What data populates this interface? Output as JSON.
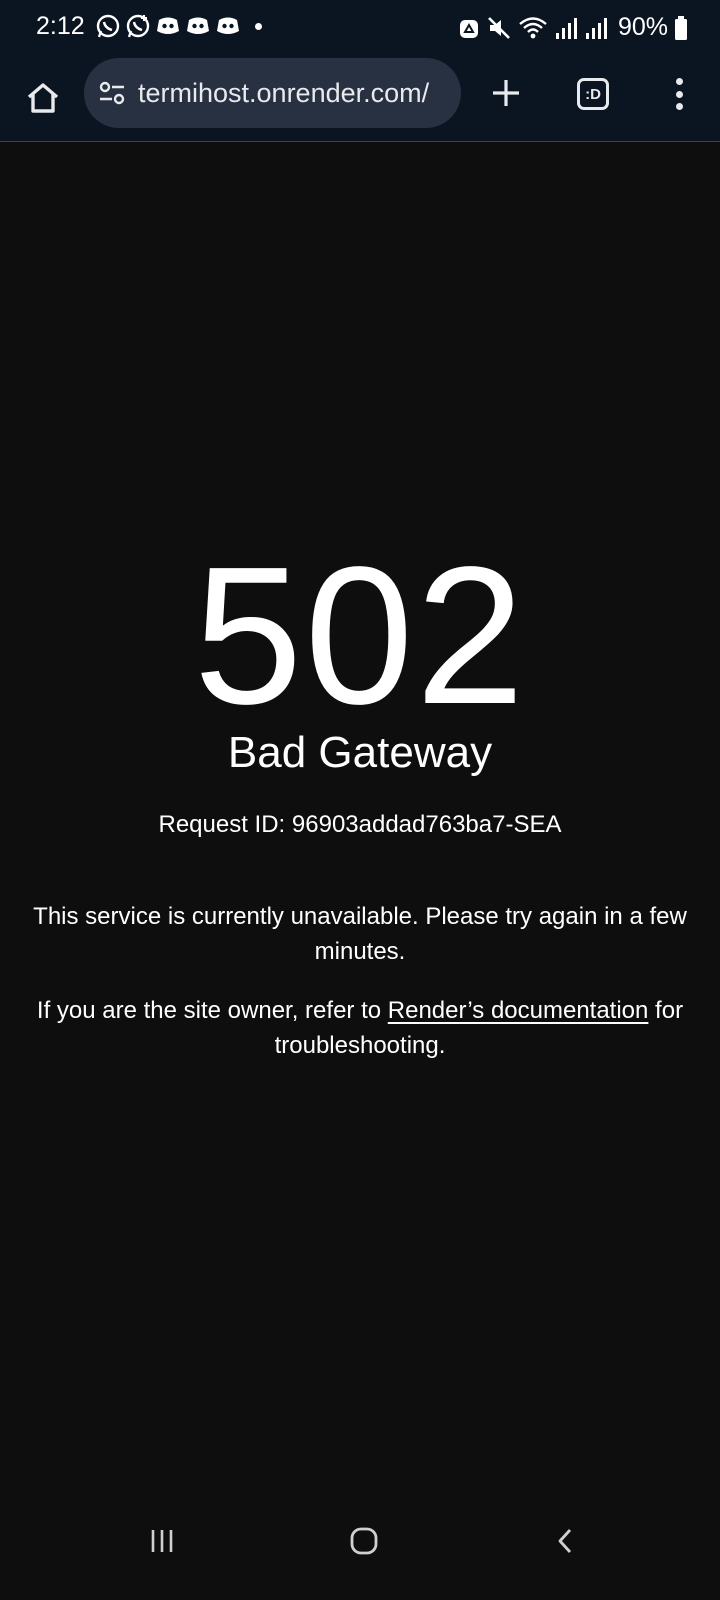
{
  "status_bar": {
    "time": "2:12",
    "battery_percent": "90%",
    "notification_icons": [
      "whatsapp-icon",
      "whatsapp-business-icon",
      "discord-icon",
      "discord-icon",
      "discord-icon"
    ],
    "system_icons": [
      "recycle-icon",
      "mute-icon",
      "wifi-icon",
      "signal-icon",
      "signal-icon",
      "battery-icon"
    ]
  },
  "toolbar": {
    "url": "termihost.onrender.com/",
    "tab_switcher_label": ":D",
    "icons": [
      "home-icon",
      "site-settings-icon",
      "new-tab-icon",
      "tab-switcher-icon",
      "more-menu-icon"
    ]
  },
  "error_page": {
    "code": "502",
    "title": "Bad Gateway",
    "request_id": "Request ID: 96903addad763ba7-SEA",
    "message": "This service is currently unavailable. Please try again in a few minutes.",
    "owner_prefix": "If you are the site owner, refer to ",
    "owner_link": "Render’s documentation",
    "owner_suffix": " for troubleshooting."
  },
  "nav_bar": {
    "icons": [
      "recents-icon",
      "home-button-icon",
      "back-icon"
    ]
  },
  "colors": {
    "page_background": "#0e0e0e",
    "toolbar_background": "#0b1421",
    "omnibox_background": "#283142",
    "text": "#ffffff"
  }
}
